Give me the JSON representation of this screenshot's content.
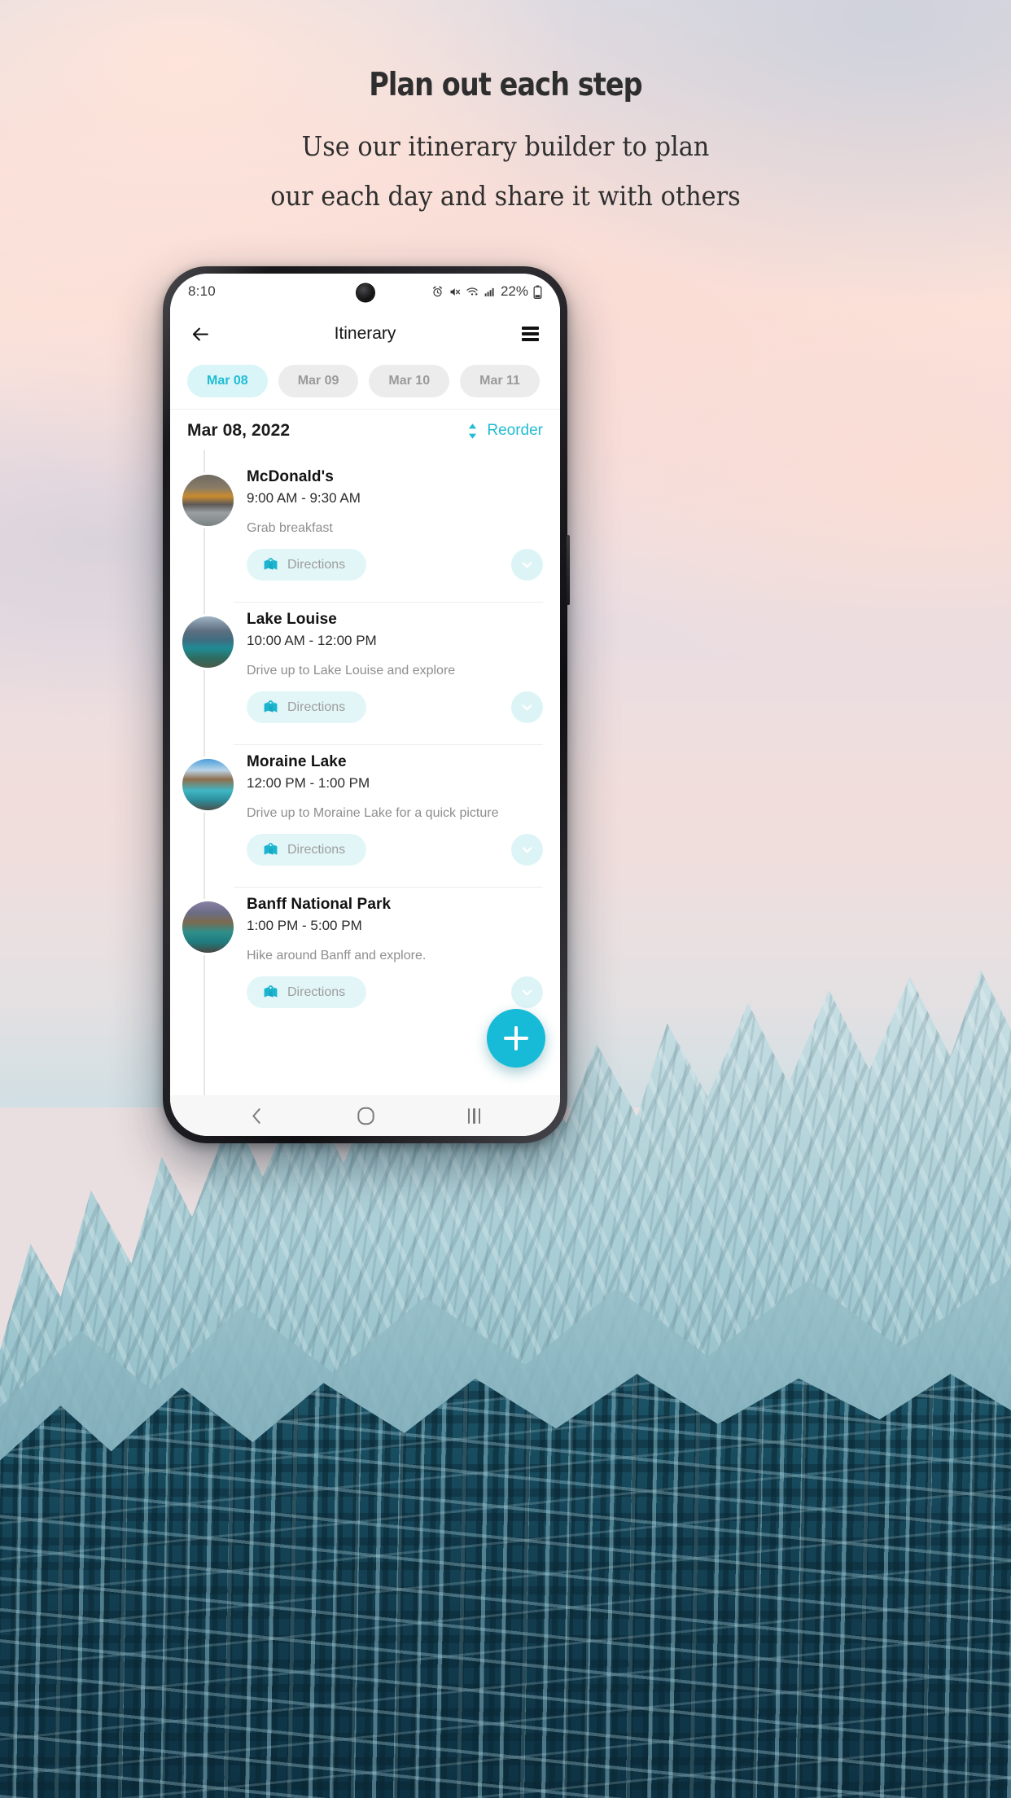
{
  "marketing": {
    "headline": "Plan out each step",
    "sub_line1": "Use our itinerary builder to plan",
    "sub_line2": "our each day and share it with others"
  },
  "phone": {
    "statusbar": {
      "time": "8:10",
      "battery": "22%",
      "icons": [
        "alarm-icon",
        "mute-icon",
        "wifi-icon",
        "signal-icon",
        "battery-icon"
      ]
    },
    "appbar": {
      "back_icon": "arrow-left-icon",
      "title": "Itinerary",
      "menu_icon": "hamburger-menu-icon"
    },
    "date_chips": [
      {
        "label": "Mar 08",
        "active": true
      },
      {
        "label": "Mar 09",
        "active": false
      },
      {
        "label": "Mar 10",
        "active": false
      },
      {
        "label": "Mar 11",
        "active": false
      }
    ],
    "date_header": {
      "date": "Mar 08, 2022",
      "reorder_label": "Reorder",
      "reorder_icon": "up-down-arrows-icon"
    },
    "items": [
      {
        "name": "McDonald's",
        "time": "9:00 AM - 9:30 AM",
        "description": "Grab breakfast",
        "directions_label": "Directions",
        "directions_icon": "map-pin-icon",
        "expand_icon": "chevron-down-icon",
        "thumb": "mcdonalds-storefront-photo"
      },
      {
        "name": "Lake Louise",
        "time": "10:00 AM - 12:00 PM",
        "description": "Drive up to Lake Louise and explore",
        "directions_label": "Directions",
        "directions_icon": "map-pin-icon",
        "expand_icon": "chevron-down-icon",
        "thumb": "lake-louise-photo"
      },
      {
        "name": "Moraine Lake",
        "time": "12:00 PM - 1:00 PM",
        "description": "Drive up to Moraine Lake for a quick picture",
        "directions_label": "Directions",
        "directions_icon": "map-pin-icon",
        "expand_icon": "chevron-down-icon",
        "thumb": "moraine-lake-photo"
      },
      {
        "name": "Banff National Park",
        "time": "1:00 PM - 5:00 PM",
        "description": "Hike around Banff and explore.",
        "directions_label": "Directions",
        "directions_icon": "map-pin-icon",
        "expand_icon": "chevron-down-icon",
        "thumb": "banff-national-park-photo"
      }
    ],
    "fab": {
      "icon": "plus-icon"
    },
    "navbar": {
      "back_icon": "nav-back-icon",
      "home_icon": "nav-home-icon",
      "recents_icon": "nav-recents-icon"
    }
  },
  "colors": {
    "accent": "#18bbd7",
    "accent_soft": "#d9f5f7",
    "chip_inactive_bg": "#ececec",
    "chip_inactive_text": "#9a9a9a",
    "muted_text": "#8e8e8e"
  }
}
